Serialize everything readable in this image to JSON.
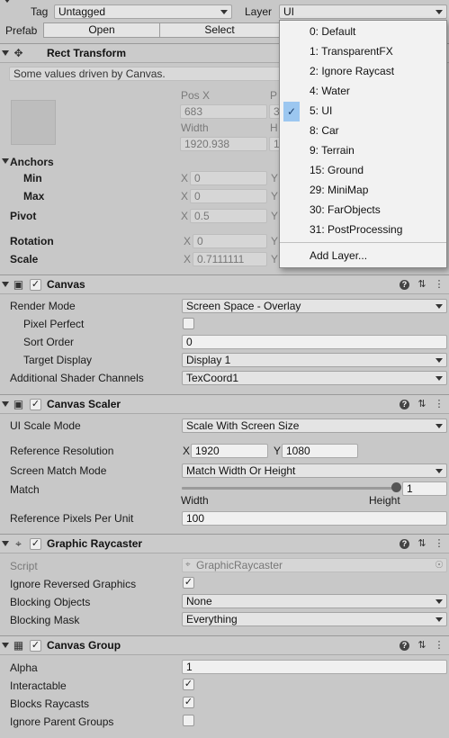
{
  "top": {
    "tag_label": "Tag",
    "tag_value": "Untagged",
    "layer_label": "Layer",
    "layer_value": "UI",
    "prefab_label": "Prefab",
    "open_label": "Open",
    "select_label": "Select"
  },
  "rect": {
    "title": "Rect Transform",
    "info": "Some values driven by Canvas.",
    "posx_label": "Pos X",
    "posy_label_partial": "P",
    "posx_value": "683",
    "posy_value_partial": "3",
    "width_label": "Width",
    "height_label_partial": "H",
    "width_value": "1920.938",
    "height_value_partial": "1",
    "anchors_label": "Anchors",
    "min_label": "Min",
    "max_label": "Max",
    "min_x": "0",
    "max_x": "0",
    "pivot_label": "Pivot",
    "pivot_x": "0.5",
    "rotation_label": "Rotation",
    "rotation_x": "0",
    "scale_label": "Scale",
    "scale_x": "0.7111111",
    "x_label": "X",
    "y_label": "Y"
  },
  "layer_menu": {
    "items": [
      {
        "label": "0: Default"
      },
      {
        "label": "1: TransparentFX"
      },
      {
        "label": "2: Ignore Raycast"
      },
      {
        "label": "4: Water"
      },
      {
        "label": "5: UI",
        "selected": true
      },
      {
        "label": "8: Car"
      },
      {
        "label": "9: Terrain"
      },
      {
        "label": "15: Ground"
      },
      {
        "label": "29: MiniMap"
      },
      {
        "label": "30: FarObjects"
      },
      {
        "label": "31: PostProcessing"
      }
    ],
    "add_layer": "Add Layer..."
  },
  "canvas": {
    "title": "Canvas",
    "render_mode_label": "Render Mode",
    "render_mode_value": "Screen Space - Overlay",
    "pixel_perfect_label": "Pixel Perfect",
    "sort_order_label": "Sort Order",
    "sort_order_value": "0",
    "target_display_label": "Target Display",
    "target_display_value": "Display 1",
    "shader_channels_label": "Additional Shader Channels",
    "shader_channels_value": "TexCoord1"
  },
  "scaler": {
    "title": "Canvas Scaler",
    "ui_scale_mode_label": "UI Scale Mode",
    "ui_scale_mode_value": "Scale With Screen Size",
    "ref_res_label": "Reference Resolution",
    "ref_x_label": "X",
    "ref_x_value": "1920",
    "ref_y_label": "Y",
    "ref_y_value": "1080",
    "match_mode_label": "Screen Match Mode",
    "match_mode_value": "Match Width Or Height",
    "match_label": "Match",
    "match_value": "1",
    "match_slider_fraction": 1,
    "width_caption": "Width",
    "height_caption": "Height",
    "ref_ppu_label": "Reference Pixels Per Unit",
    "ref_ppu_value": "100"
  },
  "raycaster": {
    "title": "Graphic Raycaster",
    "script_label": "Script",
    "script_value": "GraphicRaycaster",
    "ignore_reversed_label": "Ignore Reversed Graphics",
    "blocking_objects_label": "Blocking Objects",
    "blocking_objects_value": "None",
    "blocking_mask_label": "Blocking Mask",
    "blocking_mask_value": "Everything"
  },
  "group": {
    "title": "Canvas Group",
    "alpha_label": "Alpha",
    "alpha_value": "1",
    "interactable_label": "Interactable",
    "blocks_raycasts_label": "Blocks Raycasts",
    "ignore_parent_label": "Ignore Parent Groups"
  },
  "icons": {
    "help": "?",
    "preset": "⇅",
    "more": "⋮"
  }
}
